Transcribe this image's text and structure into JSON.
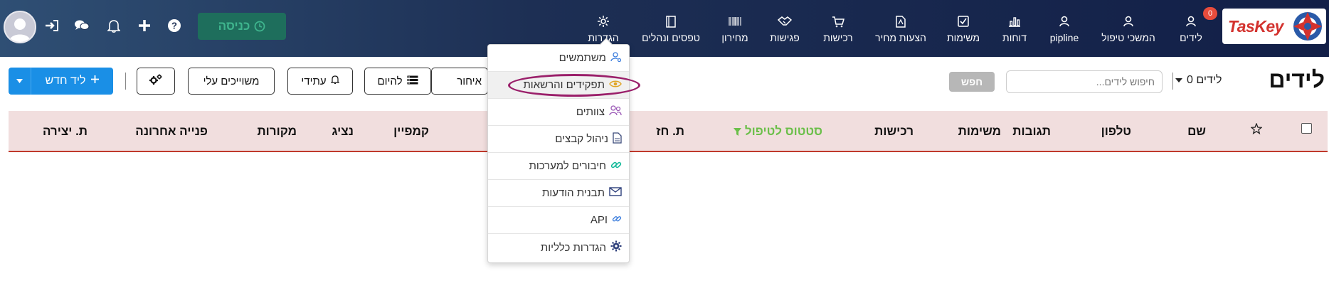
{
  "brand": {
    "logo_text": "TasKey"
  },
  "nav": {
    "leads": {
      "label": "לידים",
      "badge": "0"
    },
    "followup": {
      "label": "המשכי טיפול"
    },
    "pipline": {
      "label": "pipline"
    },
    "reports": {
      "label": "דוחות"
    },
    "tasks": {
      "label": "משימות"
    },
    "quotes": {
      "label": "הצעות מחיר"
    },
    "purchases": {
      "label": "רכישות"
    },
    "meetings": {
      "label": "פגישות"
    },
    "pricelist": {
      "label": "מחירון"
    },
    "forms": {
      "label": "טפסים ונהלים"
    },
    "settings": {
      "label": "הגדרות"
    }
  },
  "topbar": {
    "checkin_label": "כניסה"
  },
  "page": {
    "title": "לידים",
    "lead_count": "0 לידים"
  },
  "search": {
    "placeholder": "חיפוש לידים...",
    "button_label": "חפש"
  },
  "toolbar": {
    "late_label": "איחור",
    "today_label": "להיום",
    "future_label": "עתידי",
    "mine_label": "משוייכים עלי",
    "new_lead_label": "ליד חדש"
  },
  "table": {
    "headers": {
      "name": "שם",
      "phone": "טלפון",
      "responses": "תגובות",
      "tasks": "משימות",
      "purchases": "רכישות",
      "status": "סטטוס לטיפול",
      "reminder": "ת. חז",
      "campaign": "קמפיין",
      "rep": "נציג",
      "sources": "מקורות",
      "last_contact": "פנייה אחרונה",
      "created": "ת. יצירה"
    }
  },
  "settings_menu": {
    "items": [
      {
        "label": "משתמשים",
        "icon": "user-cog-icon"
      },
      {
        "label": "תפקידים והרשאות",
        "icon": "eye-icon"
      },
      {
        "label": "צוותים",
        "icon": "users-icon"
      },
      {
        "label": "ניהול קבצים",
        "icon": "file-icon"
      },
      {
        "label": "חיבורים למערכות",
        "icon": "link-icon"
      },
      {
        "label": "תבנית הודעות",
        "icon": "envelope-icon"
      },
      {
        "label": "API",
        "icon": "link-small-icon"
      },
      {
        "label": "הגדרות כלליות",
        "icon": "gear-icon"
      }
    ]
  },
  "colors": {
    "accent": "#1a8fe6",
    "status_green": "#6bbf4a",
    "header_bg": "#f1dede",
    "highlight": "#9a1f6a"
  }
}
